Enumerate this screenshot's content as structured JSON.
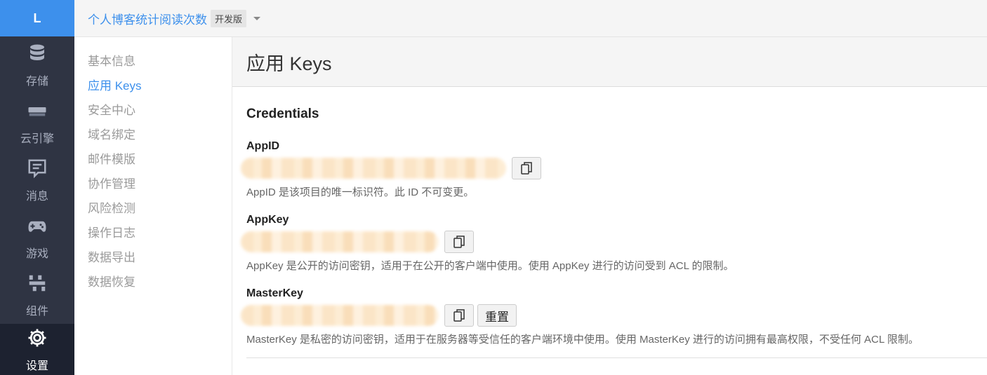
{
  "rail": {
    "logo": "L",
    "items": [
      {
        "label": "存储",
        "icon": "database-icon"
      },
      {
        "label": "云引擎",
        "icon": "server-icon"
      },
      {
        "label": "消息",
        "icon": "message-icon"
      },
      {
        "label": "游戏",
        "icon": "gamepad-icon"
      },
      {
        "label": "组件",
        "icon": "components-icon"
      },
      {
        "label": "设置",
        "icon": "gear-icon",
        "active": true
      }
    ]
  },
  "topbar": {
    "app_name": "个人博客统计阅读次数",
    "edition_badge": "开发版"
  },
  "subnav": {
    "items": [
      {
        "label": "基本信息"
      },
      {
        "label": "应用 Keys",
        "active": true
      },
      {
        "label": "安全中心"
      },
      {
        "label": "域名绑定"
      },
      {
        "label": "邮件模版"
      },
      {
        "label": "协作管理"
      },
      {
        "label": "风险检测"
      },
      {
        "label": "操作日志"
      },
      {
        "label": "数据导出"
      },
      {
        "label": "数据恢复"
      }
    ]
  },
  "main": {
    "title": "应用 Keys",
    "section_title": "Credentials",
    "keys": [
      {
        "label": "AppID",
        "desc": "AppID 是该项目的唯一标识符。此 ID 不可变更。"
      },
      {
        "label": "AppKey",
        "desc": "AppKey 是公开的访问密钥，适用于在公开的客户端中使用。使用 AppKey 进行的访问受到 ACL 的限制。"
      },
      {
        "label": "MasterKey",
        "desc": "MasterKey 是私密的访问密钥，适用于在服务器等受信任的客户端环境中使用。使用 MasterKey 进行的访问拥有最高权限，不受任何 ACL 限制。",
        "reset_label": "重置"
      }
    ]
  },
  "colors": {
    "accent": "#3d90ec",
    "rail_bg": "#2f3443",
    "rail_active_bg": "#1d2230"
  }
}
